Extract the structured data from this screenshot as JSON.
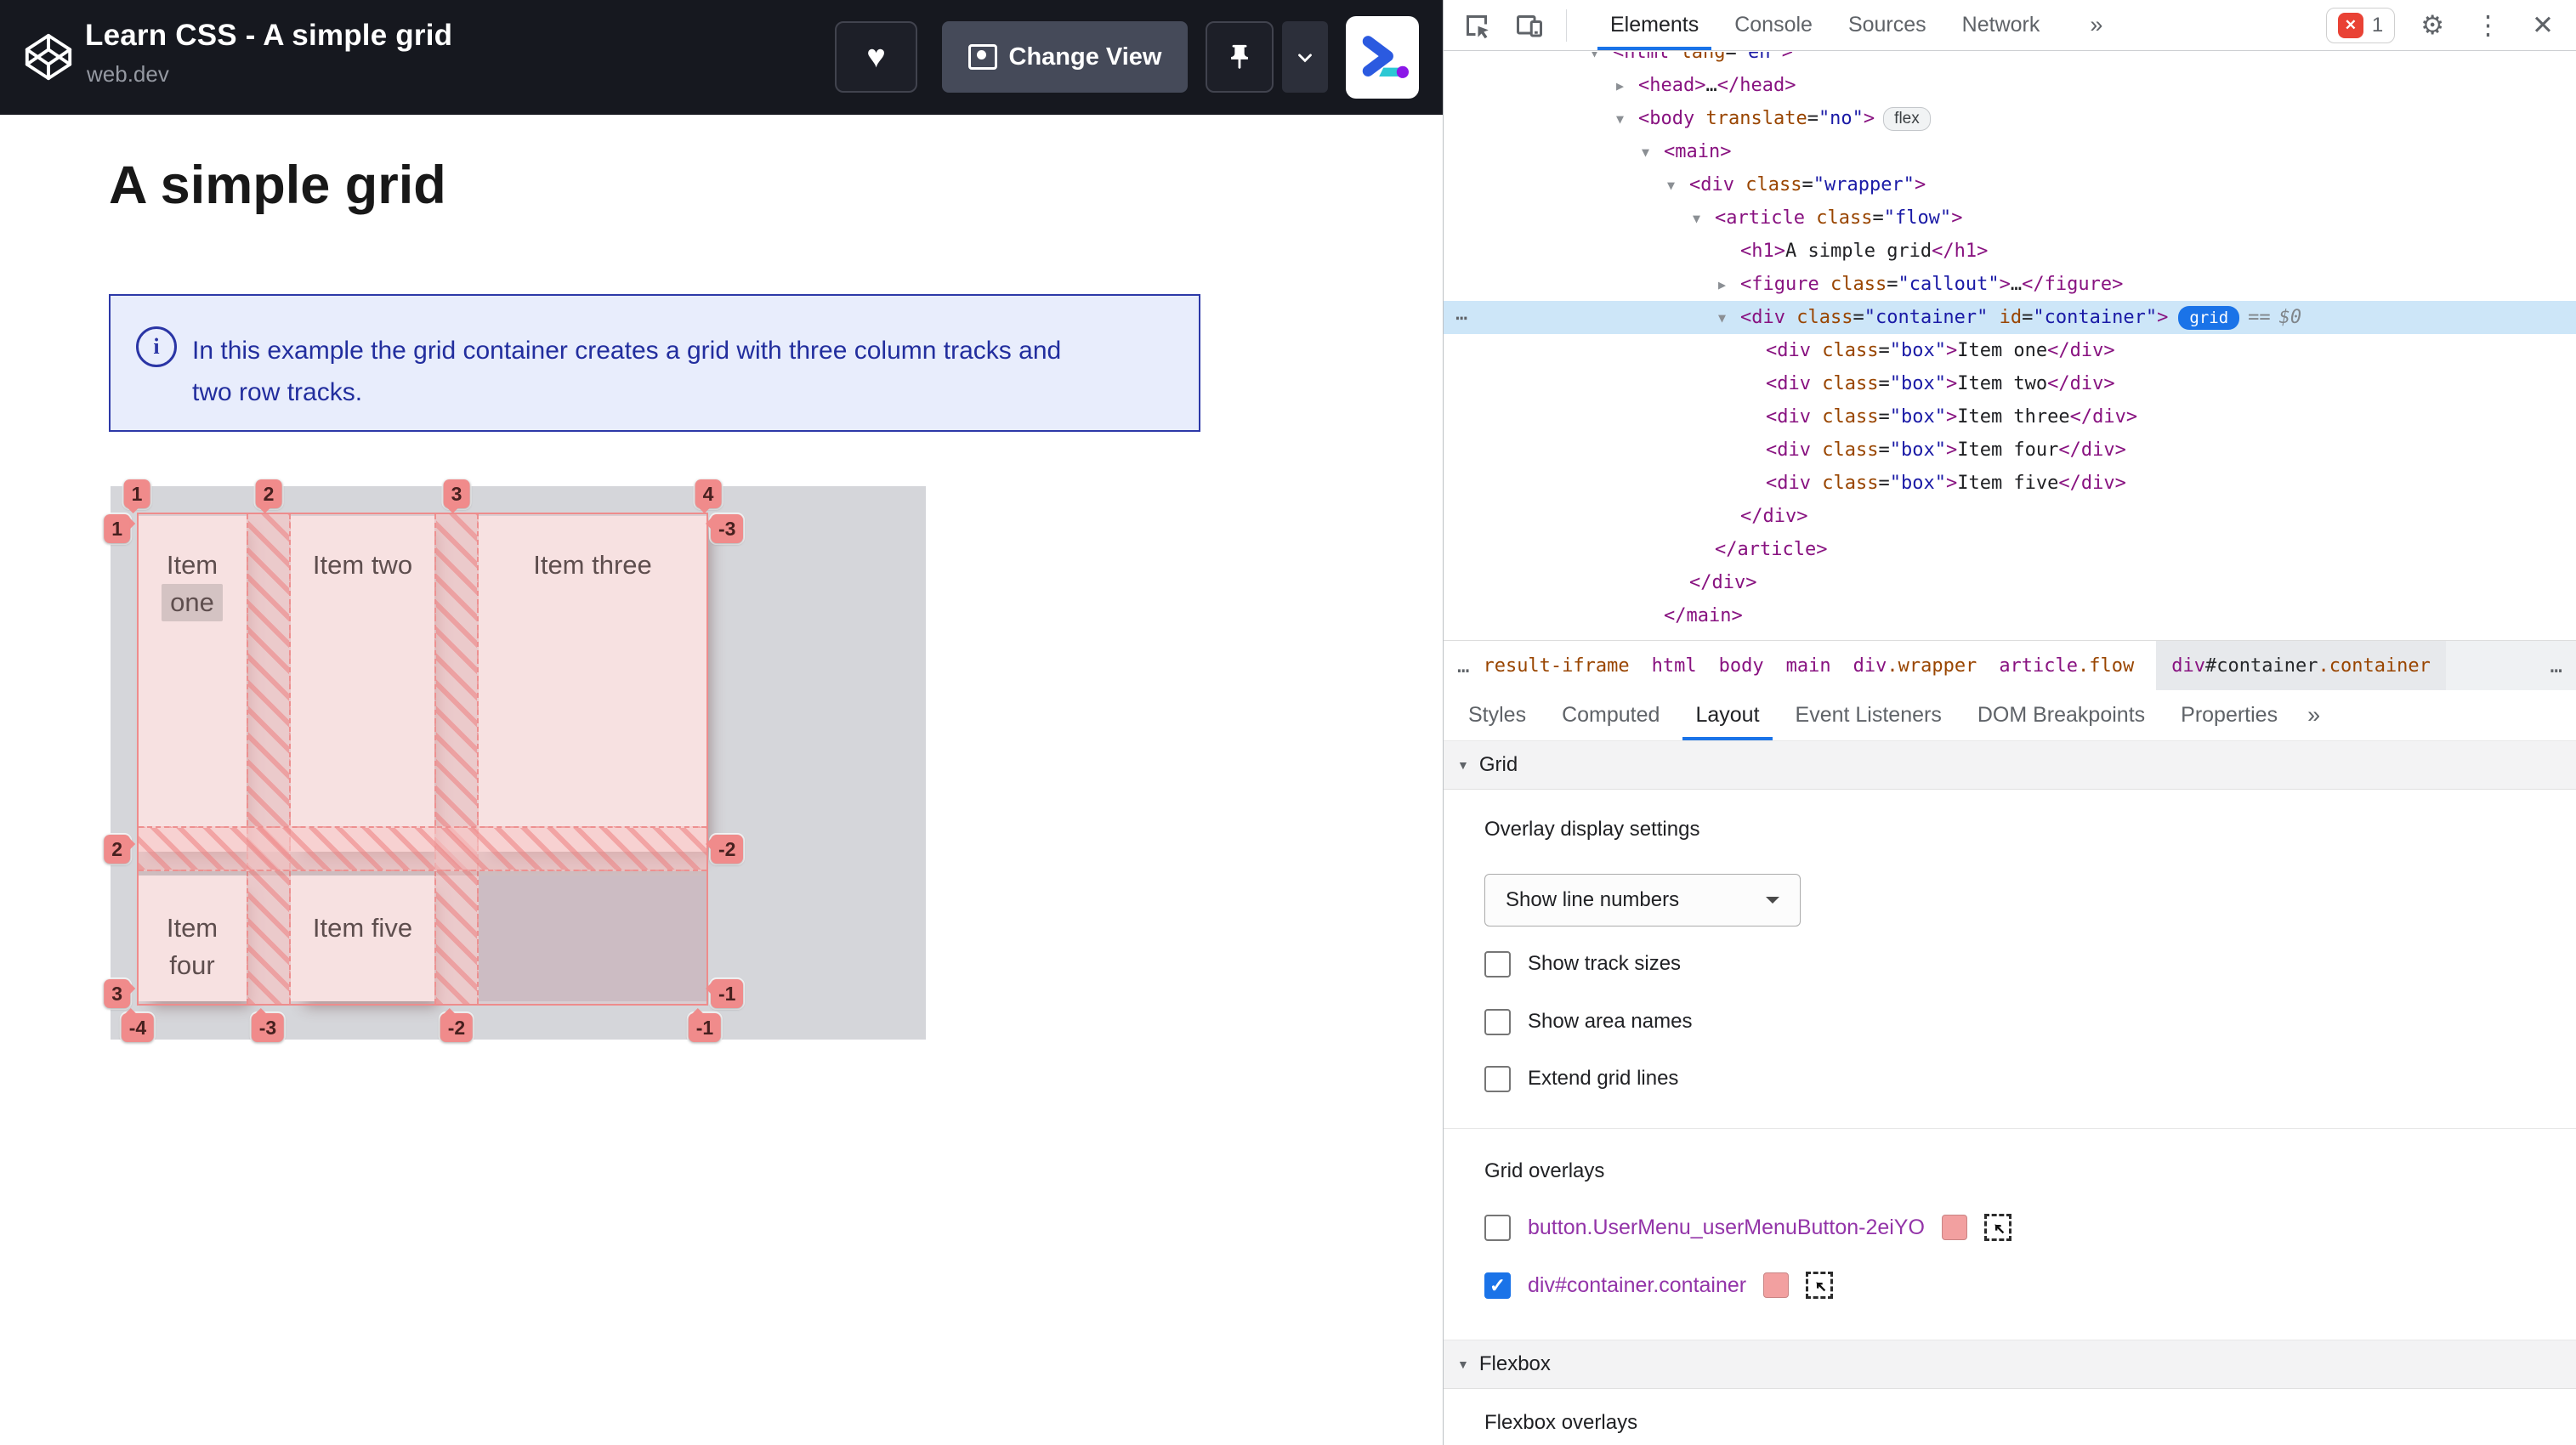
{
  "icons": {
    "heart": "♥",
    "chevron_down": "⌄",
    "gear": "⚙",
    "kebab": "⋮",
    "close": "✕",
    "error_x": "✕",
    "check": "✓",
    "dots": "…",
    "row_dots": "⋯",
    "info": "i",
    "select_arrow": "↖",
    "collapsed_arrow": "▶",
    "expanded_arrow": "▼",
    "section_tri": "▼"
  },
  "embed_header": {
    "title": "Learn CSS - A simple grid",
    "site": "web.dev",
    "change_view": "Change View"
  },
  "article": {
    "heading": "A simple grid",
    "callout_line1": "In this example the grid container creates a grid with three column tracks and",
    "callout_line2": "two row tracks."
  },
  "grid_overlay": {
    "top_badges": [
      "1",
      "2",
      "3",
      "4"
    ],
    "bottom_badges": [
      "-4",
      "-3",
      "-2",
      "-1"
    ],
    "left_badges": [
      "1",
      "2",
      "3"
    ],
    "right_badges": [
      "-3",
      "-2",
      "-1"
    ],
    "item_one_line1": "Item",
    "item_one_line2": "one",
    "item_two": "Item two",
    "item_three": "Item three",
    "item_four": "Item four",
    "item_five": "Item five",
    "overlay_color": "#f08b8b"
  },
  "devtools": {
    "toolbar": {
      "tabs": [
        "Elements",
        "Console",
        "Sources",
        "Network"
      ],
      "selected_tab": "Elements",
      "overflow": "»",
      "error_count": "1"
    },
    "dom": {
      "lines": [
        {
          "indent": 0,
          "arrow": "v",
          "segs": [
            {
              "c": "tag",
              "t": "<html"
            },
            {
              "c": "attr",
              "t": " lang"
            },
            {
              "c": "pln",
              "t": "="
            },
            {
              "c": "val",
              "t": "\"en\""
            },
            {
              "c": "tag",
              "t": ">"
            }
          ]
        },
        {
          "indent": 1,
          "arrow": "r",
          "segs": [
            {
              "c": "tag",
              "t": "<head"
            },
            {
              "c": "tag",
              "t": ">"
            },
            {
              "c": "pln",
              "t": "…"
            },
            {
              "c": "tag",
              "t": "</head>"
            }
          ]
        },
        {
          "indent": 1,
          "arrow": "v",
          "segs": [
            {
              "c": "tag",
              "t": "<body"
            },
            {
              "c": "attr",
              "t": " translate"
            },
            {
              "c": "pln",
              "t": "="
            },
            {
              "c": "val",
              "t": "\"no\""
            },
            {
              "c": "tag",
              "t": ">"
            },
            {
              "c": "bflex",
              "t": "flex"
            }
          ]
        },
        {
          "indent": 2,
          "arrow": "v",
          "segs": [
            {
              "c": "tag",
              "t": "<main>"
            }
          ]
        },
        {
          "indent": 3,
          "arrow": "v",
          "segs": [
            {
              "c": "tag",
              "t": "<div"
            },
            {
              "c": "attr",
              "t": " class"
            },
            {
              "c": "pln",
              "t": "="
            },
            {
              "c": "val",
              "t": "\"wrapper\""
            },
            {
              "c": "tag",
              "t": ">"
            }
          ]
        },
        {
          "indent": 4,
          "arrow": "v",
          "segs": [
            {
              "c": "tag",
              "t": "<article"
            },
            {
              "c": "attr",
              "t": " class"
            },
            {
              "c": "pln",
              "t": "="
            },
            {
              "c": "val",
              "t": "\"flow\""
            },
            {
              "c": "tag",
              "t": ">"
            }
          ]
        },
        {
          "indent": 5,
          "arrow": "",
          "segs": [
            {
              "c": "tag",
              "t": "<h1>"
            },
            {
              "c": "pln",
              "t": "A simple grid"
            },
            {
              "c": "tag",
              "t": "</h1>"
            }
          ]
        },
        {
          "indent": 5,
          "arrow": "r",
          "segs": [
            {
              "c": "tag",
              "t": "<figure"
            },
            {
              "c": "attr",
              "t": " class"
            },
            {
              "c": "pln",
              "t": "="
            },
            {
              "c": "val",
              "t": "\"callout\""
            },
            {
              "c": "tag",
              "t": ">"
            },
            {
              "c": "pln",
              "t": "…"
            },
            {
              "c": "tag",
              "t": "</figure>"
            }
          ]
        },
        {
          "indent": 5,
          "arrow": "v",
          "sel": true,
          "segs": [
            {
              "c": "tag",
              "t": "<div"
            },
            {
              "c": "attr",
              "t": " class"
            },
            {
              "c": "pln",
              "t": "="
            },
            {
              "c": "val",
              "t": "\"container\""
            },
            {
              "c": "attr",
              "t": " id"
            },
            {
              "c": "pln",
              "t": "="
            },
            {
              "c": "val",
              "t": "\"container\""
            },
            {
              "c": "tag",
              "t": ">"
            },
            {
              "c": "bgrid",
              "t": "grid"
            },
            {
              "c": "meta",
              "t": "=="
            },
            {
              "c": "metai",
              "t": "$0"
            }
          ]
        },
        {
          "indent": 6,
          "arrow": "",
          "segs": [
            {
              "c": "tag",
              "t": "<div"
            },
            {
              "c": "attr",
              "t": " class"
            },
            {
              "c": "pln",
              "t": "="
            },
            {
              "c": "val",
              "t": "\"box\""
            },
            {
              "c": "tag",
              "t": ">"
            },
            {
              "c": "pln",
              "t": "Item one"
            },
            {
              "c": "tag",
              "t": "</div>"
            }
          ]
        },
        {
          "indent": 6,
          "arrow": "",
          "segs": [
            {
              "c": "tag",
              "t": "<div"
            },
            {
              "c": "attr",
              "t": " class"
            },
            {
              "c": "pln",
              "t": "="
            },
            {
              "c": "val",
              "t": "\"box\""
            },
            {
              "c": "tag",
              "t": ">"
            },
            {
              "c": "pln",
              "t": "Item two"
            },
            {
              "c": "tag",
              "t": "</div>"
            }
          ]
        },
        {
          "indent": 6,
          "arrow": "",
          "segs": [
            {
              "c": "tag",
              "t": "<div"
            },
            {
              "c": "attr",
              "t": " class"
            },
            {
              "c": "pln",
              "t": "="
            },
            {
              "c": "val",
              "t": "\"box\""
            },
            {
              "c": "tag",
              "t": ">"
            },
            {
              "c": "pln",
              "t": "Item three"
            },
            {
              "c": "tag",
              "t": "</div>"
            }
          ]
        },
        {
          "indent": 6,
          "arrow": "",
          "segs": [
            {
              "c": "tag",
              "t": "<div"
            },
            {
              "c": "attr",
              "t": " class"
            },
            {
              "c": "pln",
              "t": "="
            },
            {
              "c": "val",
              "t": "\"box\""
            },
            {
              "c": "tag",
              "t": ">"
            },
            {
              "c": "pln",
              "t": "Item four"
            },
            {
              "c": "tag",
              "t": "</div>"
            }
          ]
        },
        {
          "indent": 6,
          "arrow": "",
          "segs": [
            {
              "c": "tag",
              "t": "<div"
            },
            {
              "c": "attr",
              "t": " class"
            },
            {
              "c": "pln",
              "t": "="
            },
            {
              "c": "val",
              "t": "\"box\""
            },
            {
              "c": "tag",
              "t": ">"
            },
            {
              "c": "pln",
              "t": "Item five"
            },
            {
              "c": "tag",
              "t": "</div>"
            }
          ]
        },
        {
          "indent": 5,
          "arrow": "",
          "segs": [
            {
              "c": "tag",
              "t": "</div>"
            }
          ]
        },
        {
          "indent": 4,
          "arrow": "",
          "segs": [
            {
              "c": "tag",
              "t": "</article>"
            }
          ]
        },
        {
          "indent": 3,
          "arrow": "",
          "segs": [
            {
              "c": "tag",
              "t": "</div>"
            }
          ]
        },
        {
          "indent": 2,
          "arrow": "",
          "segs": [
            {
              "c": "tag",
              "t": "</main>"
            }
          ]
        }
      ]
    },
    "breadcrumbs": {
      "overflow_left": "…",
      "overflow_right": "…",
      "crumbs": [
        {
          "parts": [
            {
              "c": "attr",
              "t": "result-iframe"
            }
          ]
        },
        {
          "parts": [
            {
              "c": "tag",
              "t": "html"
            }
          ]
        },
        {
          "parts": [
            {
              "c": "tag",
              "t": "body"
            }
          ]
        },
        {
          "parts": [
            {
              "c": "tag",
              "t": "main"
            }
          ]
        },
        {
          "parts": [
            {
              "c": "tag",
              "t": "div"
            },
            {
              "c": "attr",
              "t": ".wrapper"
            }
          ]
        },
        {
          "parts": [
            {
              "c": "tag",
              "t": "article"
            },
            {
              "c": "attr",
              "t": ".flow"
            }
          ]
        },
        {
          "parts": [
            {
              "c": "tag",
              "t": "div"
            },
            {
              "c": "id",
              "t": "#container"
            },
            {
              "c": "attr",
              "t": ".container"
            }
          ],
          "selected": true
        }
      ]
    },
    "panel_tabs": [
      "Styles",
      "Computed",
      "Layout",
      "Event Listeners",
      "DOM Breakpoints",
      "Properties"
    ],
    "panel_selected_tab": "Layout",
    "panel_overflow": "»",
    "layout_pane": {
      "grid_section": "Grid",
      "overlay_display_settings": "Overlay display settings",
      "dropdown_value": "Show line numbers",
      "checkboxes": [
        {
          "label": "Show track sizes",
          "checked": false
        },
        {
          "label": "Show area names",
          "checked": false
        },
        {
          "label": "Extend grid lines",
          "checked": false
        }
      ],
      "grid_overlays_label": "Grid overlays",
      "overlay_rows": [
        {
          "label": "button.UserMenu_userMenuButton-2eiYO",
          "checked": false,
          "swatch_color": "#f2a0a0"
        },
        {
          "label": "div#container.container",
          "checked": true,
          "swatch_color": "#f2a0a0"
        }
      ],
      "flexbox_section": "Flexbox",
      "flexbox_overlays_label": "Flexbox overlays"
    }
  }
}
